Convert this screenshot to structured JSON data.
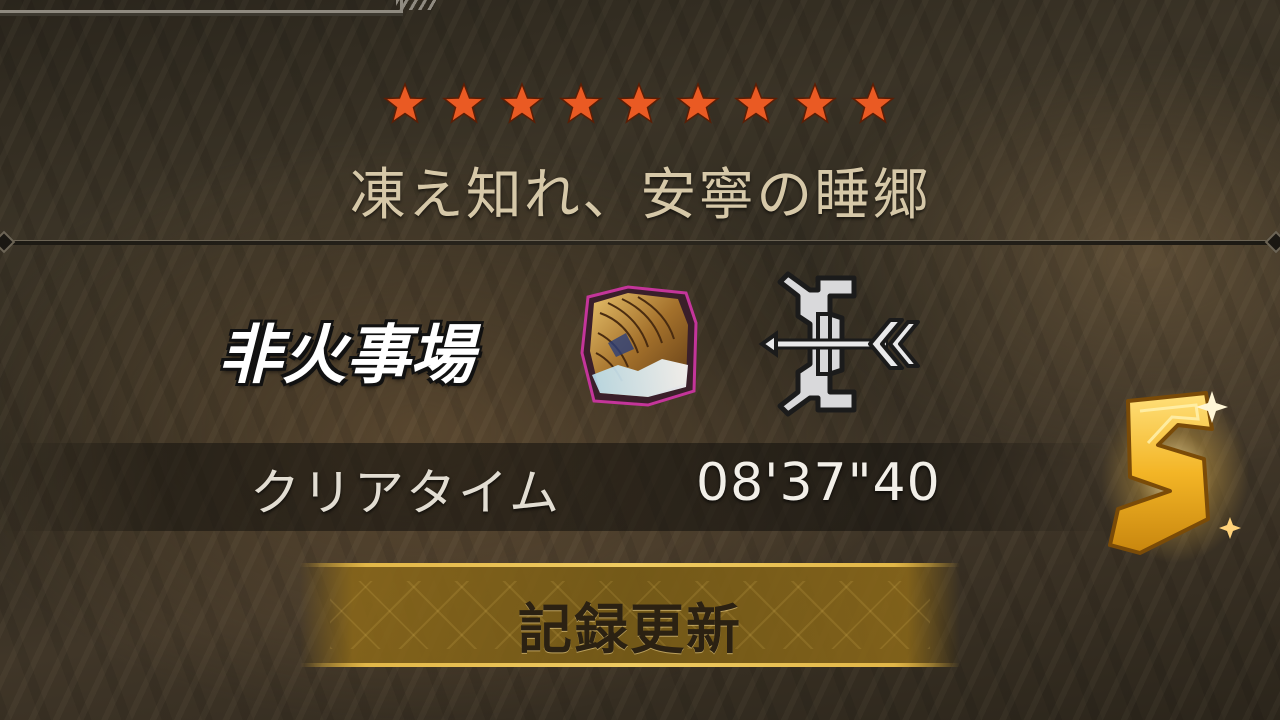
{
  "quest": {
    "star_count": 9,
    "star_color": "#ea5a23",
    "title": "凍え知れ、安寧の睡郷"
  },
  "player": {
    "name": "非火事場",
    "armor_icon": "armor-set-icon",
    "weapon_icon": "bow-icon"
  },
  "result": {
    "clear_time_label": "クリアタイム",
    "clear_time_value": "08'37\"40",
    "rank": "S",
    "rank_color": "#f3b526",
    "record_label": "記録更新"
  },
  "colors": {
    "banner_gold": "#e2b748",
    "title_text": "#d6c8a8"
  }
}
